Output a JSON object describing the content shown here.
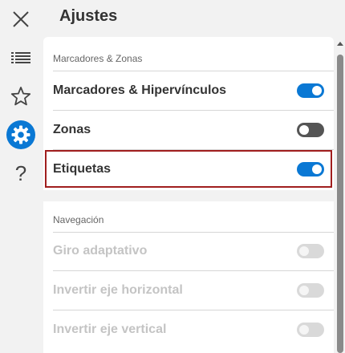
{
  "header": {
    "title": "Ajustes"
  },
  "rail": {
    "close": "close-icon",
    "list": "list-icon",
    "star": "star-icon",
    "settings": "gear-icon",
    "help_glyph": "?"
  },
  "sections": [
    {
      "label": "Marcadores & Zonas",
      "rows": [
        {
          "label": "Marcadores & Hipervínculos",
          "state": "on"
        },
        {
          "label": "Zonas",
          "state": "off"
        },
        {
          "label": "Etiquetas",
          "state": "on"
        }
      ]
    },
    {
      "label": "Navegación",
      "rows": [
        {
          "label": "Giro adaptativo",
          "state": "disabled"
        },
        {
          "label": "Invertir eje horizontal",
          "state": "disabled"
        },
        {
          "label": "Invertir eje vertical",
          "state": "disabled"
        }
      ]
    }
  ],
  "colors": {
    "accent": "#0a78d4",
    "highlight_border": "#a01e1e",
    "toggle_off": "#555555",
    "toggle_disabled": "#d9d9d9"
  }
}
